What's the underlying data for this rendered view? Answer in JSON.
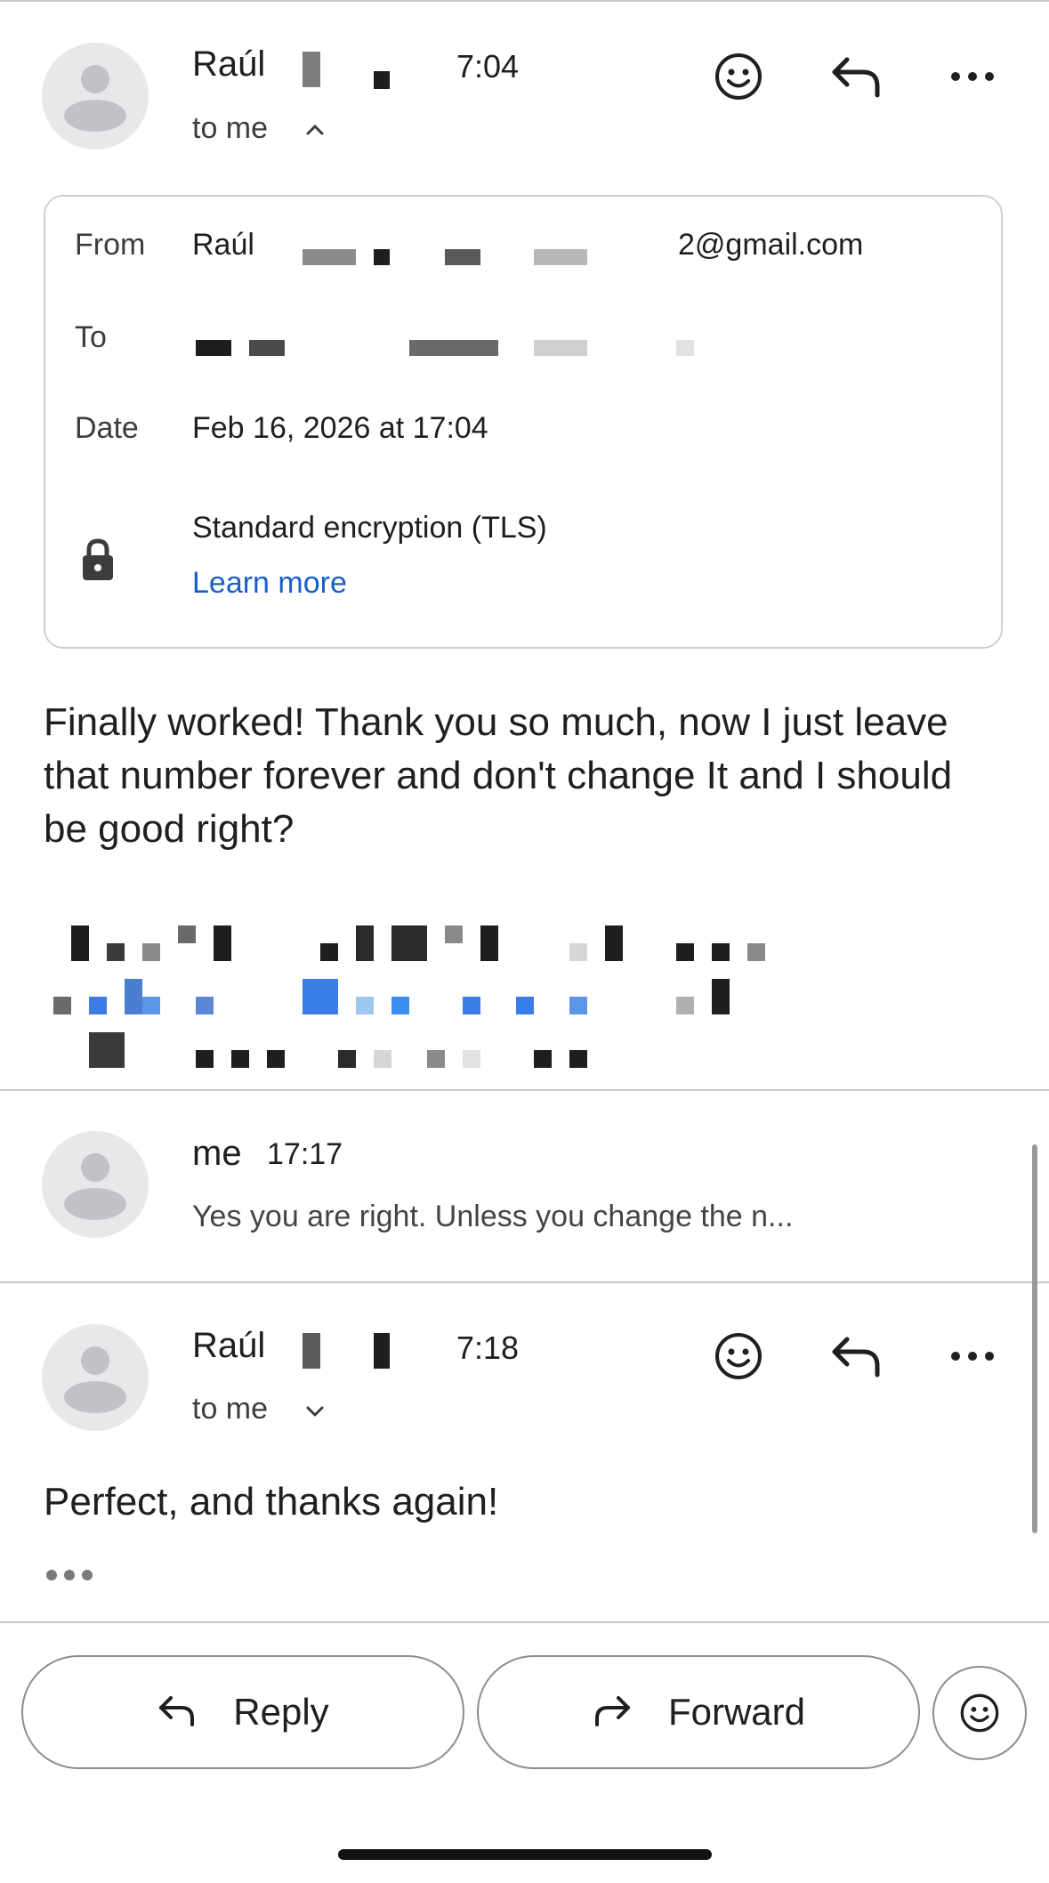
{
  "message1": {
    "sender": "Raúl",
    "time": "7:04",
    "to": "to me",
    "details": {
      "from_label": "From",
      "from_name": "Raúl",
      "from_email_suffix": "2@gmail.com",
      "to_label": "To",
      "date_label": "Date",
      "date_value": "Feb 16, 2026 at 17:04",
      "encryption": "Standard encryption (TLS)",
      "learn_more": "Learn more"
    },
    "body": "Finally worked! Thank you so much, now I just leave that number forever and don't change It and I should be good right?"
  },
  "message2": {
    "sender": "me",
    "time": "17:17",
    "snippet": "Yes you are right. Unless you change the n..."
  },
  "message3": {
    "sender": "Raúl",
    "time": "7:18",
    "to": "to me",
    "body": "Perfect, and thanks again!"
  },
  "actions": {
    "reply": "Reply",
    "forward": "Forward"
  },
  "icons": {
    "react": "smiley-icon",
    "reply": "reply-arrow-icon",
    "more": "more-horizontal-icon",
    "lock": "lock-icon",
    "forward": "forward-arrow-icon",
    "expand": "chevron-up-icon",
    "collapse": "chevron-down-icon",
    "ellipsis": "trimmed-content-icon"
  },
  "colors": {
    "link": "#1a5fc7",
    "divider": "#c9c9c9"
  }
}
